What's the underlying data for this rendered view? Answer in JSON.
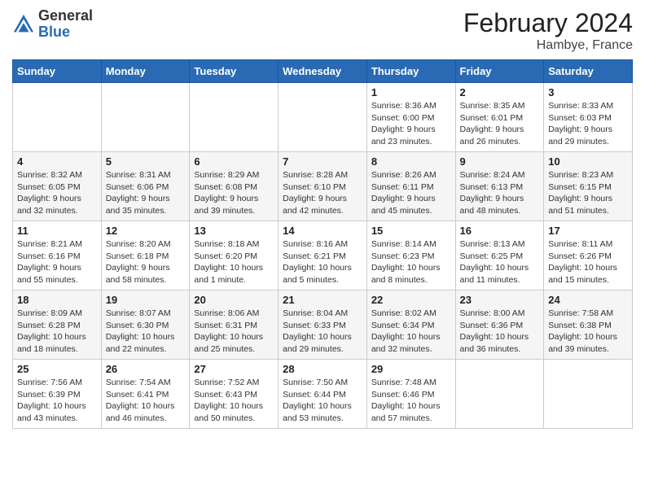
{
  "header": {
    "logo_line1": "General",
    "logo_line2": "Blue",
    "title": "February 2024",
    "location": "Hambye, France"
  },
  "days_of_week": [
    "Sunday",
    "Monday",
    "Tuesday",
    "Wednesday",
    "Thursday",
    "Friday",
    "Saturday"
  ],
  "weeks": [
    [
      {
        "day": "",
        "info": ""
      },
      {
        "day": "",
        "info": ""
      },
      {
        "day": "",
        "info": ""
      },
      {
        "day": "",
        "info": ""
      },
      {
        "day": "1",
        "info": "Sunrise: 8:36 AM\nSunset: 6:00 PM\nDaylight: 9 hours\nand 23 minutes."
      },
      {
        "day": "2",
        "info": "Sunrise: 8:35 AM\nSunset: 6:01 PM\nDaylight: 9 hours\nand 26 minutes."
      },
      {
        "day": "3",
        "info": "Sunrise: 8:33 AM\nSunset: 6:03 PM\nDaylight: 9 hours\nand 29 minutes."
      }
    ],
    [
      {
        "day": "4",
        "info": "Sunrise: 8:32 AM\nSunset: 6:05 PM\nDaylight: 9 hours\nand 32 minutes."
      },
      {
        "day": "5",
        "info": "Sunrise: 8:31 AM\nSunset: 6:06 PM\nDaylight: 9 hours\nand 35 minutes."
      },
      {
        "day": "6",
        "info": "Sunrise: 8:29 AM\nSunset: 6:08 PM\nDaylight: 9 hours\nand 39 minutes."
      },
      {
        "day": "7",
        "info": "Sunrise: 8:28 AM\nSunset: 6:10 PM\nDaylight: 9 hours\nand 42 minutes."
      },
      {
        "day": "8",
        "info": "Sunrise: 8:26 AM\nSunset: 6:11 PM\nDaylight: 9 hours\nand 45 minutes."
      },
      {
        "day": "9",
        "info": "Sunrise: 8:24 AM\nSunset: 6:13 PM\nDaylight: 9 hours\nand 48 minutes."
      },
      {
        "day": "10",
        "info": "Sunrise: 8:23 AM\nSunset: 6:15 PM\nDaylight: 9 hours\nand 51 minutes."
      }
    ],
    [
      {
        "day": "11",
        "info": "Sunrise: 8:21 AM\nSunset: 6:16 PM\nDaylight: 9 hours\nand 55 minutes."
      },
      {
        "day": "12",
        "info": "Sunrise: 8:20 AM\nSunset: 6:18 PM\nDaylight: 9 hours\nand 58 minutes."
      },
      {
        "day": "13",
        "info": "Sunrise: 8:18 AM\nSunset: 6:20 PM\nDaylight: 10 hours\nand 1 minute."
      },
      {
        "day": "14",
        "info": "Sunrise: 8:16 AM\nSunset: 6:21 PM\nDaylight: 10 hours\nand 5 minutes."
      },
      {
        "day": "15",
        "info": "Sunrise: 8:14 AM\nSunset: 6:23 PM\nDaylight: 10 hours\nand 8 minutes."
      },
      {
        "day": "16",
        "info": "Sunrise: 8:13 AM\nSunset: 6:25 PM\nDaylight: 10 hours\nand 11 minutes."
      },
      {
        "day": "17",
        "info": "Sunrise: 8:11 AM\nSunset: 6:26 PM\nDaylight: 10 hours\nand 15 minutes."
      }
    ],
    [
      {
        "day": "18",
        "info": "Sunrise: 8:09 AM\nSunset: 6:28 PM\nDaylight: 10 hours\nand 18 minutes."
      },
      {
        "day": "19",
        "info": "Sunrise: 8:07 AM\nSunset: 6:30 PM\nDaylight: 10 hours\nand 22 minutes."
      },
      {
        "day": "20",
        "info": "Sunrise: 8:06 AM\nSunset: 6:31 PM\nDaylight: 10 hours\nand 25 minutes."
      },
      {
        "day": "21",
        "info": "Sunrise: 8:04 AM\nSunset: 6:33 PM\nDaylight: 10 hours\nand 29 minutes."
      },
      {
        "day": "22",
        "info": "Sunrise: 8:02 AM\nSunset: 6:34 PM\nDaylight: 10 hours\nand 32 minutes."
      },
      {
        "day": "23",
        "info": "Sunrise: 8:00 AM\nSunset: 6:36 PM\nDaylight: 10 hours\nand 36 minutes."
      },
      {
        "day": "24",
        "info": "Sunrise: 7:58 AM\nSunset: 6:38 PM\nDaylight: 10 hours\nand 39 minutes."
      }
    ],
    [
      {
        "day": "25",
        "info": "Sunrise: 7:56 AM\nSunset: 6:39 PM\nDaylight: 10 hours\nand 43 minutes."
      },
      {
        "day": "26",
        "info": "Sunrise: 7:54 AM\nSunset: 6:41 PM\nDaylight: 10 hours\nand 46 minutes."
      },
      {
        "day": "27",
        "info": "Sunrise: 7:52 AM\nSunset: 6:43 PM\nDaylight: 10 hours\nand 50 minutes."
      },
      {
        "day": "28",
        "info": "Sunrise: 7:50 AM\nSunset: 6:44 PM\nDaylight: 10 hours\nand 53 minutes."
      },
      {
        "day": "29",
        "info": "Sunrise: 7:48 AM\nSunset: 6:46 PM\nDaylight: 10 hours\nand 57 minutes."
      },
      {
        "day": "",
        "info": ""
      },
      {
        "day": "",
        "info": ""
      }
    ]
  ]
}
